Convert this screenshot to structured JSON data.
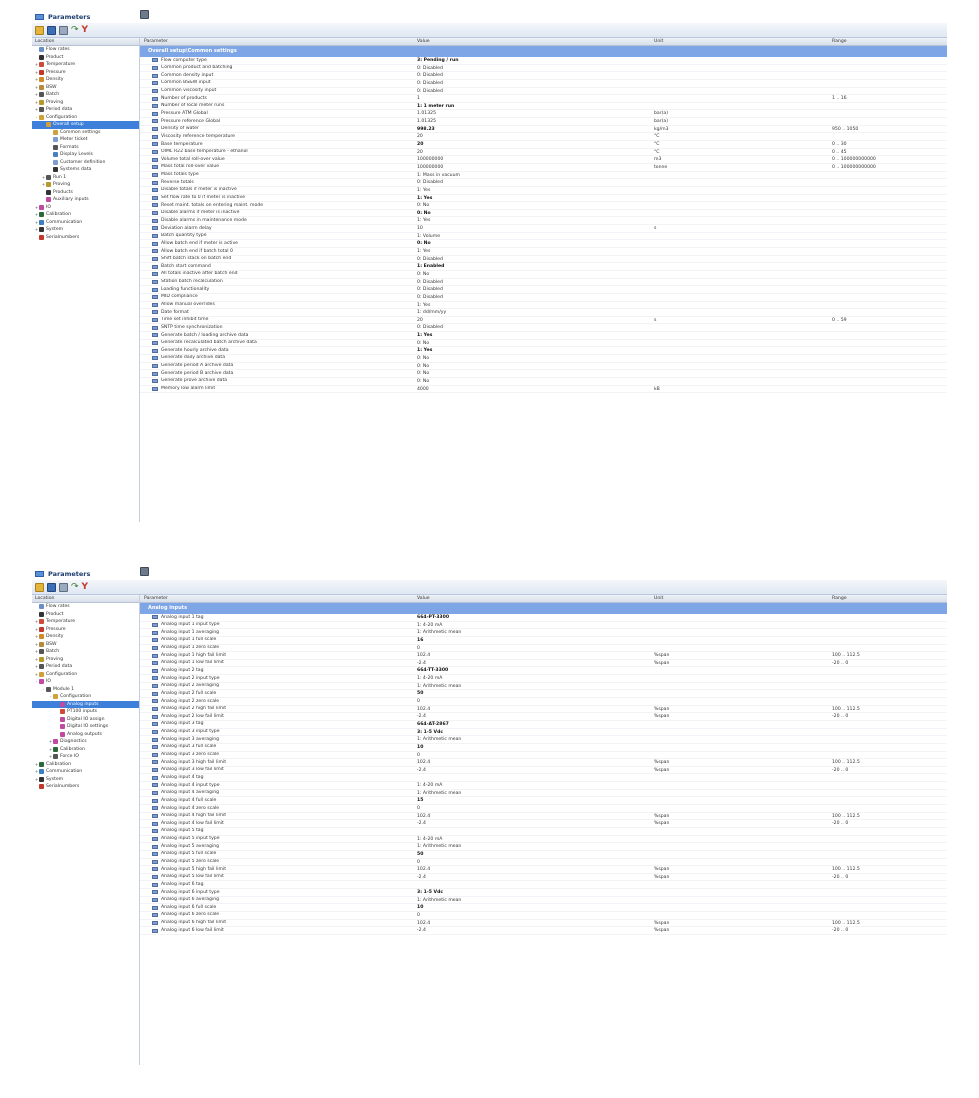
{
  "window_title": "Parameters",
  "columns": {
    "location": "Location",
    "parameter": "Parameter",
    "value": "Value",
    "unit": "Unit",
    "range": "Range"
  },
  "panel1": {
    "tree": [
      {
        "label": "Flow rates",
        "depth": 0,
        "exp": "",
        "color": "#6a8fc8"
      },
      {
        "label": "Product",
        "depth": 0,
        "exp": "",
        "color": "#333333"
      },
      {
        "label": "Temperature",
        "depth": 0,
        "exp": "+",
        "color": "#d04a3a"
      },
      {
        "label": "Pressure",
        "depth": 0,
        "exp": "+",
        "color": "#c0392b"
      },
      {
        "label": "Density",
        "depth": 0,
        "exp": "+",
        "color": "#d08a2a"
      },
      {
        "label": "BSW",
        "depth": 0,
        "exp": "+",
        "color": "#b58a3a"
      },
      {
        "label": "Batch",
        "depth": 0,
        "exp": "+",
        "color": "#555555"
      },
      {
        "label": "Proving",
        "depth": 0,
        "exp": "+",
        "color": "#b59a2a"
      },
      {
        "label": "Period data",
        "depth": 0,
        "exp": "+",
        "color": "#555555"
      },
      {
        "label": "Configuration",
        "depth": 0,
        "exp": "-",
        "color": "#d0a03a"
      },
      {
        "label": "Overall setup",
        "depth": 1,
        "exp": "-",
        "color": "#d0a03a",
        "selected": true
      },
      {
        "label": "Common settings",
        "depth": 2,
        "exp": "",
        "color": "#d0a03a"
      },
      {
        "label": "Meter ticket",
        "depth": 2,
        "exp": "",
        "color": "#7f9ccf"
      },
      {
        "label": "Formats",
        "depth": 2,
        "exp": "",
        "color": "#555555"
      },
      {
        "label": "Display Levels",
        "depth": 2,
        "exp": "",
        "color": "#4a7fc0"
      },
      {
        "label": "Customer definition",
        "depth": 2,
        "exp": "",
        "color": "#7f9ccf"
      },
      {
        "label": "Systems data",
        "depth": 2,
        "exp": "",
        "color": "#333333"
      },
      {
        "label": "Run 1",
        "depth": 1,
        "exp": "+",
        "color": "#555555"
      },
      {
        "label": "Proving",
        "depth": 1,
        "exp": "+",
        "color": "#b59a2a"
      },
      {
        "label": "Products",
        "depth": 1,
        "exp": "",
        "color": "#333333"
      },
      {
        "label": "Auxiliary inputs",
        "depth": 1,
        "exp": "",
        "color": "#c04aa0"
      },
      {
        "label": "IO",
        "depth": 0,
        "exp": "+",
        "color": "#c04aa0"
      },
      {
        "label": "Calibration",
        "depth": 0,
        "exp": "+",
        "color": "#2a6a3a"
      },
      {
        "label": "Communication",
        "depth": 0,
        "exp": "+",
        "color": "#3a7fc0"
      },
      {
        "label": "System",
        "depth": 0,
        "exp": "+",
        "color": "#333333"
      },
      {
        "label": "Serialnumbers",
        "depth": 0,
        "exp": "",
        "color": "#c0392b"
      }
    ],
    "section": "Overall setup\\Common settings",
    "rows": [
      {
        "name": "Flow computer type",
        "value": "3: Pending / run",
        "unit": "",
        "range": "",
        "bold": true
      },
      {
        "name": "Common product and batching",
        "value": "0: Disabled",
        "unit": "",
        "range": ""
      },
      {
        "name": "Common density input",
        "value": "0: Disabled",
        "unit": "",
        "range": ""
      },
      {
        "name": "Common BS&W input",
        "value": "0: Disabled",
        "unit": "",
        "range": ""
      },
      {
        "name": "Common viscosity input",
        "value": "0: Disabled",
        "unit": "",
        "range": ""
      },
      {
        "name": "Number of products",
        "value": "1",
        "unit": "",
        "range": "1 .. 16"
      },
      {
        "name": "Number of local meter runs",
        "value": "1: 1 meter run",
        "unit": "",
        "range": "",
        "bold": true
      },
      {
        "name": "Pressure ATM Global",
        "value": "1.01325",
        "unit": "bar(a)",
        "range": ""
      },
      {
        "name": "Pressure reference Global",
        "value": "1.01325",
        "unit": "bar(a)",
        "range": ""
      },
      {
        "name": "Density of water",
        "value": "998.23",
        "unit": "kg/m3",
        "range": "950 .. 1050",
        "bold": true
      },
      {
        "name": "Viscosity reference temperature",
        "value": "20",
        "unit": "°C",
        "range": ""
      },
      {
        "name": "Base temperature",
        "value": "20",
        "unit": "°C",
        "range": "0 .. 30",
        "bold": true
      },
      {
        "name": "OIML R22 base temperature - ethanol",
        "value": "20",
        "unit": "°C",
        "range": "0 .. 45"
      },
      {
        "name": "Volume total roll-over value",
        "value": "100000000",
        "unit": "m3",
        "range": "0 .. 100000000000"
      },
      {
        "name": "Mass total roll-over value",
        "value": "100000000",
        "unit": "tonne",
        "range": "0 .. 100000000000"
      },
      {
        "name": "Mass totals type",
        "value": "1: Mass in vacuum",
        "unit": "",
        "range": ""
      },
      {
        "name": "Reverse totals",
        "value": "0: Disabled",
        "unit": "",
        "range": ""
      },
      {
        "name": "Disable totals if meter is inactive",
        "value": "1: Yes",
        "unit": "",
        "range": ""
      },
      {
        "name": "Set flow rate to 0 if meter is inactive",
        "value": "1: Yes",
        "unit": "",
        "range": "",
        "bold": true
      },
      {
        "name": "Reset maint. totals on entering maint. mode",
        "value": "0: No",
        "unit": "",
        "range": ""
      },
      {
        "name": "Disable alarms if meter is inactive",
        "value": "0: No",
        "unit": "",
        "range": "",
        "bold": true
      },
      {
        "name": "Disable alarms in maintenance mode",
        "value": "1: Yes",
        "unit": "",
        "range": ""
      },
      {
        "name": "Deviation alarm delay",
        "value": "10",
        "unit": "s",
        "range": ""
      },
      {
        "name": "Batch quantity type",
        "value": "1: Volume",
        "unit": "",
        "range": ""
      },
      {
        "name": "Allow batch end if meter is active",
        "value": "0: No",
        "unit": "",
        "range": "",
        "bold": true
      },
      {
        "name": "Allow batch end if batch total 0",
        "value": "1: Yes",
        "unit": "",
        "range": ""
      },
      {
        "name": "Shift batch stack on batch end",
        "value": "0: Disabled",
        "unit": "",
        "range": ""
      },
      {
        "name": "Batch start command",
        "value": "1: Enabled",
        "unit": "",
        "range": "",
        "bold": true
      },
      {
        "name": "All totals inactive after batch end",
        "value": "0: No",
        "unit": "",
        "range": ""
      },
      {
        "name": "Station batch recalculation",
        "value": "0: Disabled",
        "unit": "",
        "range": ""
      },
      {
        "name": "Loading functionality",
        "value": "0: Disabled",
        "unit": "",
        "range": ""
      },
      {
        "name": "MID compliance",
        "value": "0: Disabled",
        "unit": "",
        "range": ""
      },
      {
        "name": "Allow manual overrides",
        "value": "1: Yes",
        "unit": "",
        "range": ""
      },
      {
        "name": "Date format",
        "value": "1: dd/mm/yy",
        "unit": "",
        "range": ""
      },
      {
        "name": "Time set inhibit time",
        "value": "20",
        "unit": "s",
        "range": "0 .. 59"
      },
      {
        "name": "SNTP time synchronization",
        "value": "0: Disabled",
        "unit": "",
        "range": ""
      },
      {
        "name": "Generate batch / loading archive data",
        "value": "1: Yes",
        "unit": "",
        "range": "",
        "bold": true
      },
      {
        "name": "Generate recalculated batch archive data",
        "value": "0: No",
        "unit": "",
        "range": ""
      },
      {
        "name": "Generate hourly archive data",
        "value": "1: Yes",
        "unit": "",
        "range": "",
        "bold": true
      },
      {
        "name": "Generate daily archive data",
        "value": "0: No",
        "unit": "",
        "range": ""
      },
      {
        "name": "Generate period A archive data",
        "value": "0: No",
        "unit": "",
        "range": ""
      },
      {
        "name": "Generate period B archive data",
        "value": "0: No",
        "unit": "",
        "range": ""
      },
      {
        "name": "Generate prove archive data",
        "value": "0: No",
        "unit": "",
        "range": ""
      },
      {
        "name": "Memory low alarm limit",
        "value": "4000",
        "unit": "kB",
        "range": ""
      }
    ]
  },
  "panel2": {
    "tree": [
      {
        "label": "Flow rates",
        "depth": 0,
        "exp": "",
        "color": "#6a8fc8"
      },
      {
        "label": "Product",
        "depth": 0,
        "exp": "",
        "color": "#333333"
      },
      {
        "label": "Temperature",
        "depth": 0,
        "exp": "+",
        "color": "#d04a3a"
      },
      {
        "label": "Pressure",
        "depth": 0,
        "exp": "+",
        "color": "#c0392b"
      },
      {
        "label": "Density",
        "depth": 0,
        "exp": "+",
        "color": "#d08a2a"
      },
      {
        "label": "BSW",
        "depth": 0,
        "exp": "+",
        "color": "#b58a3a"
      },
      {
        "label": "Batch",
        "depth": 0,
        "exp": "+",
        "color": "#555555"
      },
      {
        "label": "Proving",
        "depth": 0,
        "exp": "+",
        "color": "#b59a2a"
      },
      {
        "label": "Period data",
        "depth": 0,
        "exp": "+",
        "color": "#555555"
      },
      {
        "label": "Configuration",
        "depth": 0,
        "exp": "+",
        "color": "#d0a03a"
      },
      {
        "label": "IO",
        "depth": 0,
        "exp": "-",
        "color": "#c04aa0"
      },
      {
        "label": "Module 1",
        "depth": 1,
        "exp": "-",
        "color": "#555555"
      },
      {
        "label": "Configuration",
        "depth": 2,
        "exp": "-",
        "color": "#d0a03a"
      },
      {
        "label": "Analog inputs",
        "depth": 3,
        "exp": "",
        "color": "#c04aa0",
        "selected": true
      },
      {
        "label": "PT100 inputs",
        "depth": 3,
        "exp": "",
        "color": "#d04a3a"
      },
      {
        "label": "Digital IO assign",
        "depth": 3,
        "exp": "",
        "color": "#c04aa0"
      },
      {
        "label": "Digital IO settings",
        "depth": 3,
        "exp": "",
        "color": "#c04aa0"
      },
      {
        "label": "Analog outputs",
        "depth": 3,
        "exp": "",
        "color": "#c04aa0"
      },
      {
        "label": "Diagnostics",
        "depth": 2,
        "exp": "+",
        "color": "#c04aa0"
      },
      {
        "label": "Calibration",
        "depth": 2,
        "exp": "+",
        "color": "#2a6a3a"
      },
      {
        "label": "Force IO",
        "depth": 2,
        "exp": "+",
        "color": "#555555"
      },
      {
        "label": "Calibration",
        "depth": 0,
        "exp": "+",
        "color": "#2a6a3a"
      },
      {
        "label": "Communication",
        "depth": 0,
        "exp": "+",
        "color": "#3a7fc0"
      },
      {
        "label": "System",
        "depth": 0,
        "exp": "+",
        "color": "#333333"
      },
      {
        "label": "Serialnumbers",
        "depth": 0,
        "exp": "",
        "color": "#c0392b"
      }
    ],
    "section": "Analog inputs",
    "rows": [
      {
        "name": "Analog input 1 tag",
        "value": "664-PT-3300",
        "unit": "",
        "range": "",
        "bold": true
      },
      {
        "name": "Analog input 1 input type",
        "value": "1: 4-20 mA",
        "unit": "",
        "range": ""
      },
      {
        "name": "Analog input 1 averaging",
        "value": "1: Arithmetic mean",
        "unit": "",
        "range": ""
      },
      {
        "name": "Analog input 1 full scale",
        "value": "16",
        "unit": "",
        "range": "",
        "bold": true
      },
      {
        "name": "Analog input 1 zero scale",
        "value": "0",
        "unit": "",
        "range": ""
      },
      {
        "name": "Analog input 1 high fail limit",
        "value": "102.4",
        "unit": "%span",
        "range": "100 .. 112.5"
      },
      {
        "name": "Analog input 1 low fail limit",
        "value": "-2.4",
        "unit": "%span",
        "range": "-20 .. 0"
      },
      {
        "name": "Analog input 2 tag",
        "value": "664-TT-3300",
        "unit": "",
        "range": "",
        "bold": true
      },
      {
        "name": "Analog input 2 input type",
        "value": "1: 4-20 mA",
        "unit": "",
        "range": ""
      },
      {
        "name": "Analog input 2 averaging",
        "value": "1: Arithmetic mean",
        "unit": "",
        "range": ""
      },
      {
        "name": "Analog input 2 full scale",
        "value": "50",
        "unit": "",
        "range": "",
        "bold": true
      },
      {
        "name": "Analog input 2 zero scale",
        "value": "0",
        "unit": "",
        "range": ""
      },
      {
        "name": "Analog input 2 high fail limit",
        "value": "102.4",
        "unit": "%span",
        "range": "100 .. 112.5"
      },
      {
        "name": "Analog input 2 low fail limit",
        "value": "-2.4",
        "unit": "%span",
        "range": "-20 .. 0"
      },
      {
        "name": "Analog input 3 tag",
        "value": "664-AT-2867",
        "unit": "",
        "range": "",
        "bold": true
      },
      {
        "name": "Analog input 3 input type",
        "value": "3: 1-5 Vdc",
        "unit": "",
        "range": "",
        "bold": true
      },
      {
        "name": "Analog input 3 averaging",
        "value": "1: Arithmetic mean",
        "unit": "",
        "range": ""
      },
      {
        "name": "Analog input 3 full scale",
        "value": "10",
        "unit": "",
        "range": "",
        "bold": true
      },
      {
        "name": "Analog input 3 zero scale",
        "value": "0",
        "unit": "",
        "range": ""
      },
      {
        "name": "Analog input 3 high fail limit",
        "value": "102.4",
        "unit": "%span",
        "range": "100 .. 112.5"
      },
      {
        "name": "Analog input 3 low fail limit",
        "value": "-2.4",
        "unit": "%span",
        "range": "-20 .. 0"
      },
      {
        "name": "Analog input 4 tag",
        "value": "",
        "unit": "",
        "range": ""
      },
      {
        "name": "Analog input 4 input type",
        "value": "1: 4-20 mA",
        "unit": "",
        "range": ""
      },
      {
        "name": "Analog input 4 averaging",
        "value": "1: Arithmetic mean",
        "unit": "",
        "range": ""
      },
      {
        "name": "Analog input 4 full scale",
        "value": "15",
        "unit": "",
        "range": "",
        "bold": true
      },
      {
        "name": "Analog input 4 zero scale",
        "value": "0",
        "unit": "",
        "range": ""
      },
      {
        "name": "Analog input 4 high fail limit",
        "value": "102.4",
        "unit": "%span",
        "range": "100 .. 112.5"
      },
      {
        "name": "Analog input 4 low fail limit",
        "value": "-2.4",
        "unit": "%span",
        "range": "-20 .. 0"
      },
      {
        "name": "Analog input 5 tag",
        "value": "",
        "unit": "",
        "range": ""
      },
      {
        "name": "Analog input 5 input type",
        "value": "1: 4-20 mA",
        "unit": "",
        "range": ""
      },
      {
        "name": "Analog input 5 averaging",
        "value": "1: Arithmetic mean",
        "unit": "",
        "range": ""
      },
      {
        "name": "Analog input 5 full scale",
        "value": "50",
        "unit": "",
        "range": "",
        "bold": true
      },
      {
        "name": "Analog input 5 zero scale",
        "value": "0",
        "unit": "",
        "range": ""
      },
      {
        "name": "Analog input 5 high fail limit",
        "value": "102.4",
        "unit": "%span",
        "range": "100 .. 112.5"
      },
      {
        "name": "Analog input 5 low fail limit",
        "value": "-2.4",
        "unit": "%span",
        "range": "-20 .. 0"
      },
      {
        "name": "Analog input 6 tag",
        "value": "",
        "unit": "",
        "range": ""
      },
      {
        "name": "Analog input 6 input type",
        "value": "3: 1-5 Vdc",
        "unit": "",
        "range": "",
        "bold": true
      },
      {
        "name": "Analog input 6 averaging",
        "value": "1: Arithmetic mean",
        "unit": "",
        "range": ""
      },
      {
        "name": "Analog input 6 full scale",
        "value": "10",
        "unit": "",
        "range": "",
        "bold": true
      },
      {
        "name": "Analog input 6 zero scale",
        "value": "0",
        "unit": "",
        "range": ""
      },
      {
        "name": "Analog input 6 high fail limit",
        "value": "102.4",
        "unit": "%span",
        "range": "100 .. 112.5"
      },
      {
        "name": "Analog input 6 low fail limit",
        "value": "-2.4",
        "unit": "%span",
        "range": "-20 .. 0"
      }
    ]
  }
}
